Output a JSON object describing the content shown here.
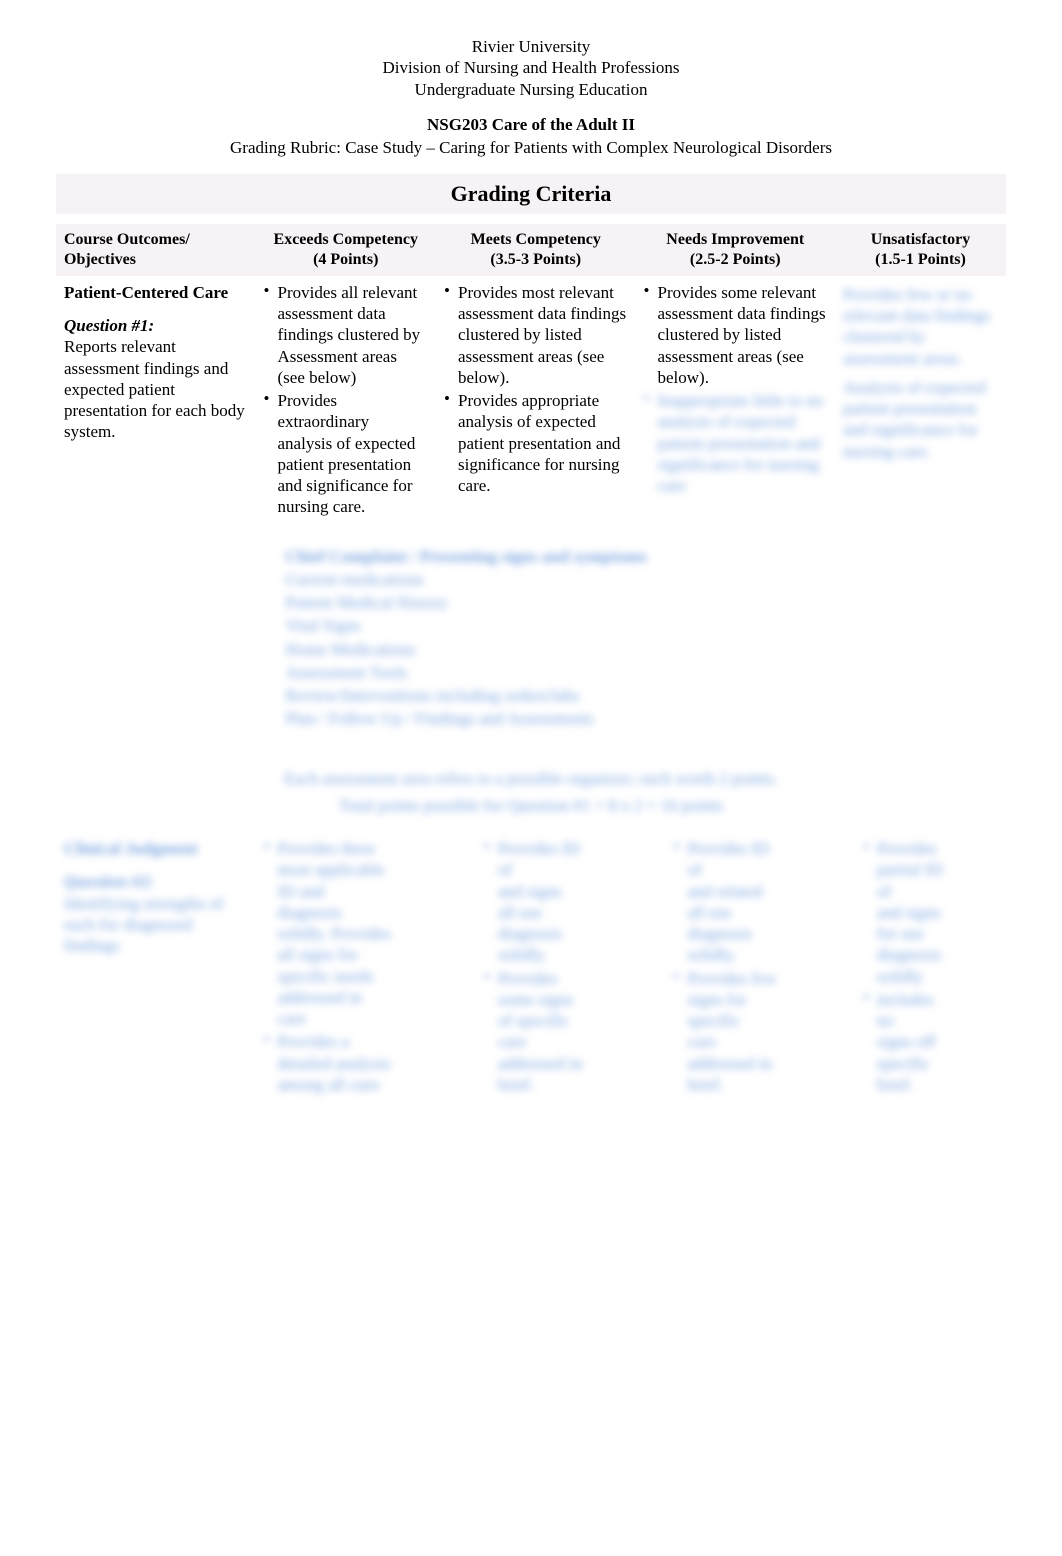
{
  "header": {
    "line1": "Rivier University",
    "line2": "Division of Nursing and Health Professions",
    "line3": "Undergraduate Nursing Education"
  },
  "course_title": "NSG203 Care of the Adult II",
  "subtitle": "Grading Rubric: Case Study – Caring for Patients with Complex Neurological Disorders",
  "criteria_heading": "Grading Criteria",
  "columns": {
    "c1": "Course Outcomes/ Objectives",
    "c2a": "Exceeds Competency",
    "c2b": "(4 Points)",
    "c3a": "Meets Competency",
    "c3b": "(3.5-3 Points)",
    "c4a": "Needs Improvement",
    "c4b": "(2.5-2 Points)",
    "c5a": "Unsatisfactory",
    "c5b": "(1.5-1 Points)"
  },
  "row1": {
    "obj_title": "Patient-Centered Care",
    "question": "Question #1:",
    "obj_text": "Reports relevant assessment findings and expected patient presentation for each body system.",
    "exceeds": [
      "Provides all relevant assessment data findings clustered by Assessment areas (see below)",
      "Provides extraordinary analysis of expected patient presentation and significance for nursing care."
    ],
    "meets": [
      "Provides most relevant assessment data findings clustered by listed assessment areas (see below).",
      "Provides appropriate analysis of expected patient presentation and significance for nursing care."
    ],
    "needs": [
      "Provides some relevant assessment data findings clustered by listed assessment areas (see below)."
    ],
    "unsat_blur": [
      "Provides few or no relevant data findings clustered by assessment areas.",
      "Analysis of expected patient presentation and significance for nursing care."
    ]
  },
  "assessment_block_blur": [
    "Chief Complaint / Presenting signs and symptoms",
    "Current medications",
    "Patient Medical History",
    "Vital Signs",
    "Home Medications",
    "Assessment Tools",
    "Review/Interventions including orders/labs",
    "Plan / Follow Up / Findings and Assessments"
  ],
  "notes_blur": [
    "Each assessment area refers to a possible organizer; each worth 2 points.",
    "Total points possible for Question #1 = 8 x 2 = 16 points"
  ],
  "row2_blur": {
    "obj": [
      "Clinical Judgment",
      "Question #2:",
      "Identifying strengths of",
      "each for diagnosed",
      "findings"
    ],
    "exceeds": [
      "Provides three",
      "most applicable",
      "ID and",
      "diagnosis",
      "solidly. Provides",
      "all signs for",
      "specific needs",
      "addressed in",
      "care",
      "Provides a",
      "detailed analysis",
      "among all cues"
    ],
    "meets": [
      "Provides ID",
      "of",
      "and signs",
      "all use",
      "diagnosis",
      "solidly.",
      "Provides",
      "some signs",
      "of specific",
      "care",
      "addressed in",
      "brief."
    ],
    "needs": [
      "Provides ID",
      "of",
      "and related",
      "all use",
      "diagnosis",
      "solidly.",
      "Provides few",
      "signs for",
      "specific",
      "care",
      "addressed in",
      "brief."
    ],
    "unsat": [
      "Provides",
      "partial ID",
      "of",
      "and signs",
      "for use",
      "diagnosis",
      "solidly",
      "includes",
      "no",
      "signs off",
      "specific",
      "brief."
    ]
  }
}
